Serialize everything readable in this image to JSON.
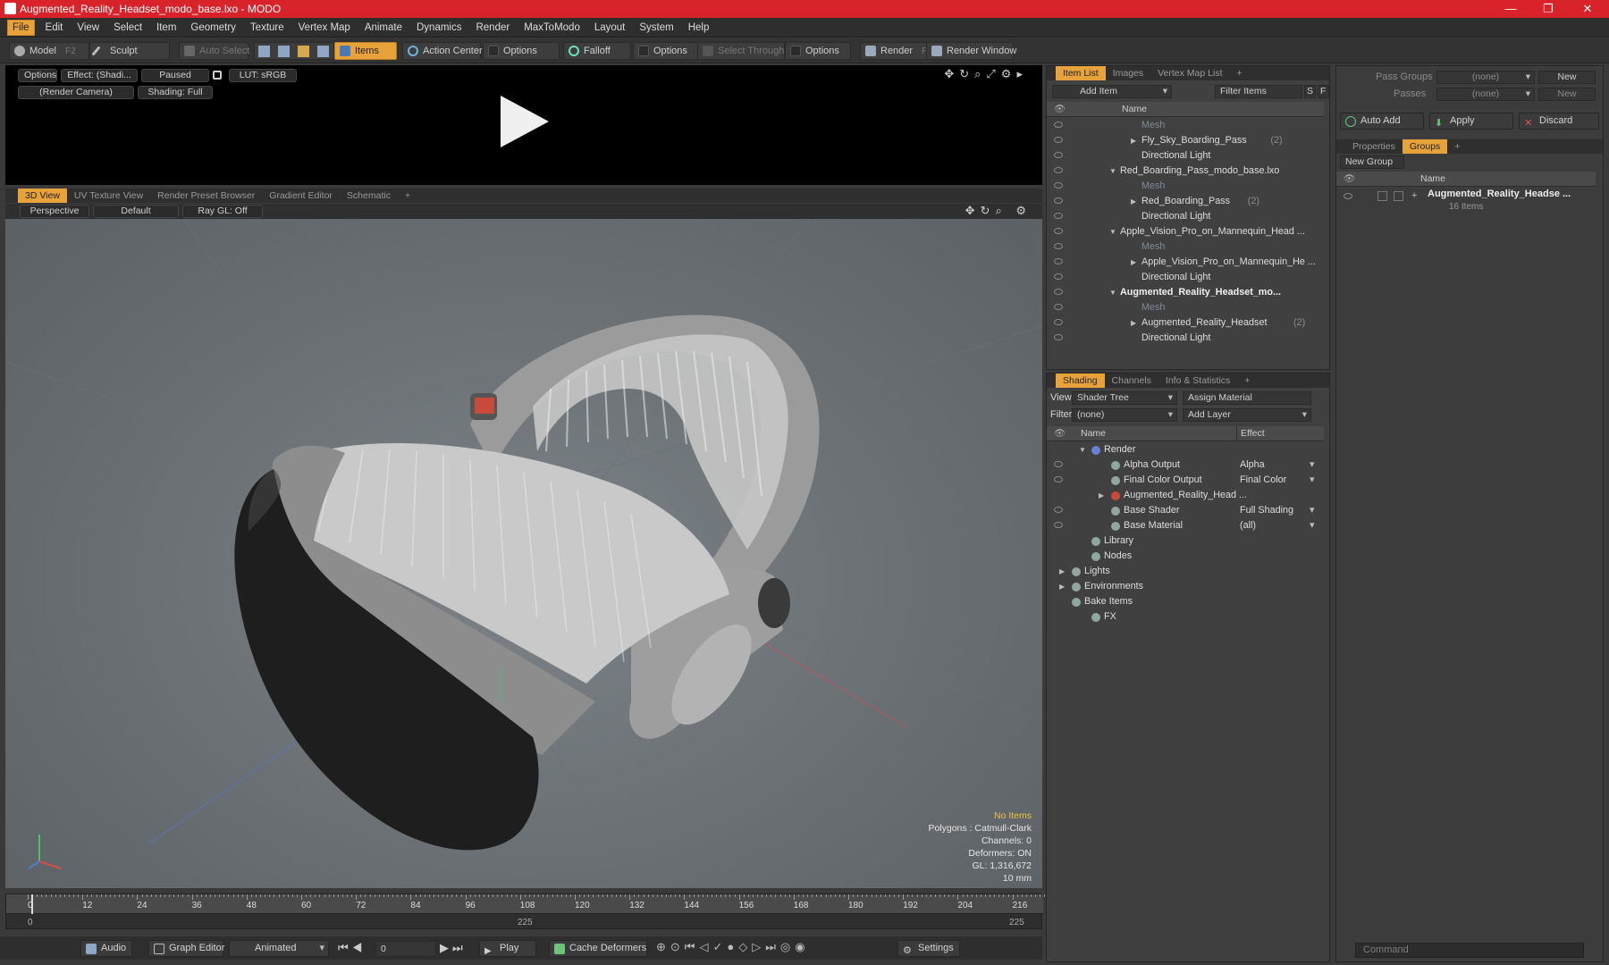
{
  "window": {
    "title": "Augmented_Reality_Headset_modo_base.lxo - MODO",
    "controls": [
      "—",
      "❐",
      "✕"
    ]
  },
  "menu": [
    "File",
    "Edit",
    "View",
    "Select",
    "Item",
    "Geometry",
    "Texture",
    "Vertex Map",
    "Animate",
    "Dynamics",
    "Render",
    "MaxToModo",
    "Layout",
    "System",
    "Help"
  ],
  "toolbar": {
    "model": "Model",
    "model_key": "F2",
    "sculpt": "Sculpt",
    "auto_select": "Auto Select",
    "items": "Items",
    "action_center": "Action Center",
    "options1": "Options",
    "falloff": "Falloff",
    "options2": "Options",
    "select_through": "Select Through",
    "options3": "Options",
    "render": "Render",
    "render_key": "F9",
    "render_window": "Render Window"
  },
  "render_preview": {
    "options": "Options",
    "effect": "Effect: (Shadi...",
    "paused": "Paused",
    "lut": "LUT: sRGB",
    "camera": "(Render Camera)",
    "shading": "Shading: Full"
  },
  "viewport": {
    "tabs": [
      "3D View",
      "UV Texture View",
      "Render Preset Browser",
      "Gradient Editor",
      "Schematic"
    ],
    "perspective": "Perspective",
    "default": "Default",
    "raygl": "Ray GL: Off",
    "info": {
      "items": "No Items",
      "polygons": "Polygons : Catmull-Clark",
      "channels": "Channels: 0",
      "deformers": "Deformers: ON",
      "gl": "GL: 1,316,672",
      "unit": "10 mm"
    }
  },
  "timeline": {
    "ticks": [
      "0",
      "12",
      "24",
      "36",
      "48",
      "60",
      "72",
      "84",
      "96",
      "108",
      "120",
      "132",
      "144",
      "156",
      "168",
      "180",
      "192",
      "204",
      "216"
    ],
    "start": "0",
    "mid": "225",
    "end": "225"
  },
  "transport": {
    "audio": "Audio",
    "graph_editor": "Graph Editor",
    "animated": "Animated",
    "frame": "0",
    "play": "Play",
    "cache": "Cache Deformers",
    "settings": "Settings"
  },
  "itemlist": {
    "tabs": [
      "Item List",
      "Images",
      "Vertex Map List"
    ],
    "add_item": "Add Item",
    "filter": "Filter Items",
    "col_name": "Name",
    "rows": [
      {
        "label": "Mesh",
        "dim": true,
        "indent": 3
      },
      {
        "label": "Fly_Sky_Boarding_Pass",
        "count": "(2)",
        "indent": 3,
        "tri": "▶"
      },
      {
        "label": "Directional Light",
        "indent": 3
      },
      {
        "label": "Red_Boarding_Pass_modo_base.lxo",
        "indent": 1,
        "tri": "▼"
      },
      {
        "label": "Mesh",
        "dim": true,
        "indent": 3
      },
      {
        "label": "Red_Boarding_Pass",
        "count": "(2)",
        "indent": 3,
        "tri": "▶"
      },
      {
        "label": "Directional Light",
        "indent": 3
      },
      {
        "label": "Apple_Vision_Pro_on_Mannequin_Head ...",
        "indent": 1,
        "tri": "▼"
      },
      {
        "label": "Mesh",
        "dim": true,
        "indent": 3
      },
      {
        "label": "Apple_Vision_Pro_on_Mannequin_He ...",
        "indent": 3,
        "tri": "▶"
      },
      {
        "label": "Directional Light",
        "indent": 3
      },
      {
        "label": "Augmented_Reality_Headset_mo...",
        "indent": 1,
        "tri": "▼",
        "bold": true
      },
      {
        "label": "Mesh",
        "dim": true,
        "indent": 3
      },
      {
        "label": "Augmented_Reality_Headset",
        "count": "(2)",
        "indent": 3,
        "tri": "▶"
      },
      {
        "label": "Directional Light",
        "indent": 3
      }
    ]
  },
  "shading": {
    "tabs": [
      "Shading",
      "Channels",
      "Info & Statistics"
    ],
    "view_label": "View",
    "view_value": "Shader Tree",
    "assign": "Assign Material",
    "filter_label": "Filter",
    "filter_value": "(none)",
    "add_layer": "Add Layer",
    "col_name": "Name",
    "col_effect": "Effect",
    "rows": [
      {
        "label": "Render",
        "effect": "",
        "indent": 0,
        "tri": "▼"
      },
      {
        "label": "Alpha Output",
        "effect": "Alpha",
        "indent": 1
      },
      {
        "label": "Final Color Output",
        "effect": "Final Color",
        "indent": 1
      },
      {
        "label": "Augmented_Reality_Head ...",
        "effect": "",
        "indent": 1,
        "tri": "▶"
      },
      {
        "label": "Base Shader",
        "effect": "Full Shading",
        "indent": 1
      },
      {
        "label": "Base Material",
        "effect": "(all)",
        "indent": 1
      },
      {
        "label": "Library",
        "effect": "",
        "indent": 0
      },
      {
        "label": "Nodes",
        "effect": "",
        "indent": 0
      },
      {
        "label": "Lights",
        "effect": "",
        "indent": -1,
        "tri": "▶"
      },
      {
        "label": "Environments",
        "effect": "",
        "indent": -1,
        "tri": "▶"
      },
      {
        "label": "Bake Items",
        "effect": "",
        "indent": -1
      },
      {
        "label": "FX",
        "effect": "",
        "indent": 0
      }
    ]
  },
  "groups": {
    "pass_groups": "Pass Groups",
    "passes": "Passes",
    "none": "(none)",
    "new": "New",
    "auto_add": "Auto Add",
    "apply": "Apply",
    "discard": "Discard",
    "tabs": [
      "Properties",
      "Groups"
    ],
    "new_group": "New Group",
    "col_name": "Name",
    "group_name": "Augmented_Reality_Headse ...",
    "group_items": "16 Items"
  },
  "command": {
    "placeholder": "Command"
  }
}
